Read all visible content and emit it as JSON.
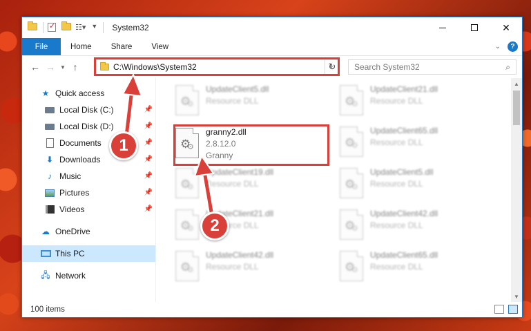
{
  "window": {
    "title": "System32"
  },
  "ribbon": {
    "tabs": [
      {
        "label": "File"
      },
      {
        "label": "Home"
      },
      {
        "label": "Share"
      },
      {
        "label": "View"
      }
    ]
  },
  "address": {
    "path": "C:\\Windows\\System32"
  },
  "search": {
    "placeholder": "Search System32"
  },
  "nav": {
    "quick_access": "Quick access",
    "items": [
      {
        "label": "Local Disk (C:)"
      },
      {
        "label": "Local Disk (D:)"
      },
      {
        "label": "Documents"
      },
      {
        "label": "Downloads"
      },
      {
        "label": "Music"
      },
      {
        "label": "Pictures"
      },
      {
        "label": "Videos"
      }
    ],
    "onedrive": "OneDrive",
    "this_pc": "This PC",
    "network": "Network"
  },
  "files": {
    "left": [
      {
        "name": "UpdateClient5.dll",
        "line2": "Resource DLL"
      },
      {
        "name": "granny2.dll",
        "line2": "2.8.12.0",
        "line3": "Granny"
      },
      {
        "name": "UpdateClient19.dll",
        "line2": "Resource DLL"
      },
      {
        "name": "UpdateClient21.dll",
        "line2": "Resource DLL"
      },
      {
        "name": "UpdateClient42.dll",
        "line2": "Resource DLL"
      }
    ],
    "right": [
      {
        "name": "UpdateClient21.dll",
        "line2": "Resource DLL"
      },
      {
        "name": "UpdateClient65.dll",
        "line2": "Resource DLL"
      },
      {
        "name": "UpdateClient5.dll",
        "line2": "Resource DLL"
      },
      {
        "name": "UpdateClient42.dll",
        "line2": "Resource DLL"
      },
      {
        "name": "UpdateClient65.dll",
        "line2": "Resource DLL"
      }
    ]
  },
  "status": {
    "items_count": "100 items"
  },
  "callouts": {
    "one": "1",
    "two": "2"
  },
  "colors": {
    "accent": "#1979ca",
    "highlight": "#d9403a",
    "selected": "#cce8ff"
  }
}
